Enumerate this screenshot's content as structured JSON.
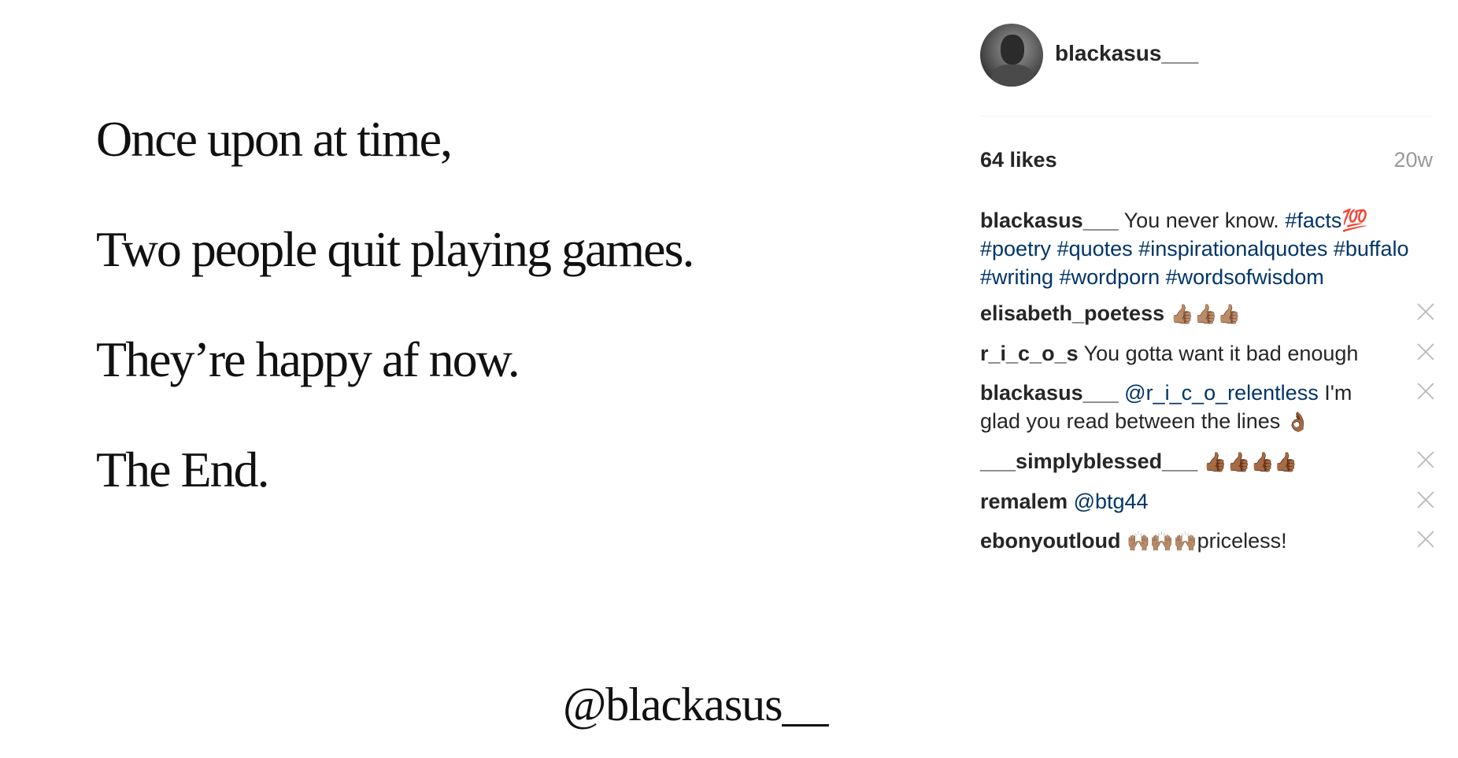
{
  "post": {
    "quote_lines": [
      "Once upon at time,",
      "Two people quit playing games.",
      "They’re happy af now.",
      "The End."
    ],
    "watermark": "@blackasus__"
  },
  "header": {
    "username": "blackasus___",
    "avatar_icon": "avatar-photo"
  },
  "stats": {
    "likes": "64 likes",
    "time": "20w"
  },
  "caption": {
    "user": "blackasus___",
    "text": " You never know. ",
    "tags": [
      "#facts💯",
      "#poetry",
      "#quotes",
      "#inspirationalquotes",
      "#buffalo",
      "#writing",
      "#wordporn",
      "#wordsofwisdom"
    ]
  },
  "comments": [
    {
      "user": "elisabeth_poetess",
      "text": " ",
      "emoji": "👍🏽👍🏽👍🏽",
      "icon": "close-icon"
    },
    {
      "user": "r_i_c_o_s",
      "text": " You gotta want it bad enough",
      "emoji": "",
      "icon": "close-icon"
    },
    {
      "user": "blackasus___",
      "mention": "@r_i_c_o_relentless",
      "text": " I'm glad you read between the lines ",
      "emoji": "👌🏾",
      "icon": "close-icon"
    },
    {
      "user": "___simplyblessed___",
      "text": " ",
      "emoji": "👍🏾👍🏾👍🏾👍🏾",
      "icon": "close-icon"
    },
    {
      "user": "remalem",
      "mention": "@btg44",
      "text": "",
      "emoji": "",
      "icon": "close-icon"
    },
    {
      "user": "ebonyoutloud",
      "text": "priceless!",
      "emoji": "🙌🏽🙌🏽🙌🏽",
      "icon": "close-icon"
    }
  ],
  "colors": {
    "link": "#003569",
    "text": "#262626",
    "muted": "#999999",
    "divider": "#efefef"
  }
}
